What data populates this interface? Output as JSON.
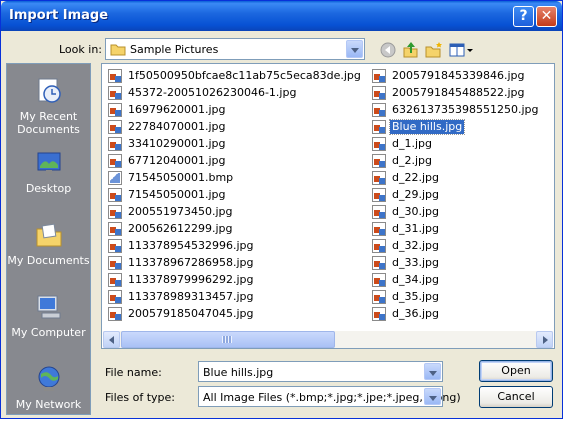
{
  "window": {
    "title": "Import Image",
    "help_label": "?",
    "close_label": "✕"
  },
  "look_in": {
    "label": "Look in:",
    "value": "Sample Pictures",
    "icons": [
      "back-icon",
      "up-folder-icon",
      "new-folder-icon",
      "view-menu-icon"
    ]
  },
  "places": [
    {
      "label": "My Recent Documents",
      "icon": "recent-documents-icon"
    },
    {
      "label": "Desktop",
      "icon": "desktop-icon"
    },
    {
      "label": "My Documents",
      "icon": "my-documents-icon"
    },
    {
      "label": "My Computer",
      "icon": "my-computer-icon"
    },
    {
      "label": "My Network",
      "icon": "my-network-icon"
    }
  ],
  "files_col1": [
    "1f50500950bfcae8c11ab75c5eca83de.jpg",
    "45372-20051026230046-1.jpg",
    "16979620001.jpg",
    "22784070001.jpg",
    "33410290001.jpg",
    "67712040001.jpg",
    "71545050001.bmp",
    "71545050001.jpg",
    "200551973450.jpg",
    "200562612299.jpg",
    "113378954532996.jpg",
    "113378967286958.jpg",
    "113378979996292.jpg",
    "113378989313457.jpg",
    "200579185047045.jpg"
  ],
  "files_col2": [
    "2005791845339846.jpg",
    "2005791845488522.jpg",
    "632613735398551250.jpg",
    "Blue hills.jpg",
    "d_1.jpg",
    "d_2.jpg",
    "d_22.jpg",
    "d_29.jpg",
    "d_30.jpg",
    "d_31.jpg",
    "d_32.jpg",
    "d_33.jpg",
    "d_34.jpg",
    "d_35.jpg",
    "d_36.jpg"
  ],
  "selected_file": "Blue hills.jpg",
  "file_name": {
    "label": "File name:",
    "value": "Blue hills.jpg"
  },
  "file_type": {
    "label": "Files of type:",
    "value": "All Image Files (*.bmp;*.jpg;*.jpe;*.jpeg, *.png)"
  },
  "buttons": {
    "open": "Open",
    "cancel": "Cancel"
  },
  "colors": {
    "title_bar": "#0a5fd6",
    "places_bg": "#87898f",
    "selection": "#316ac5",
    "dialog_bg": "#ece9d8"
  }
}
